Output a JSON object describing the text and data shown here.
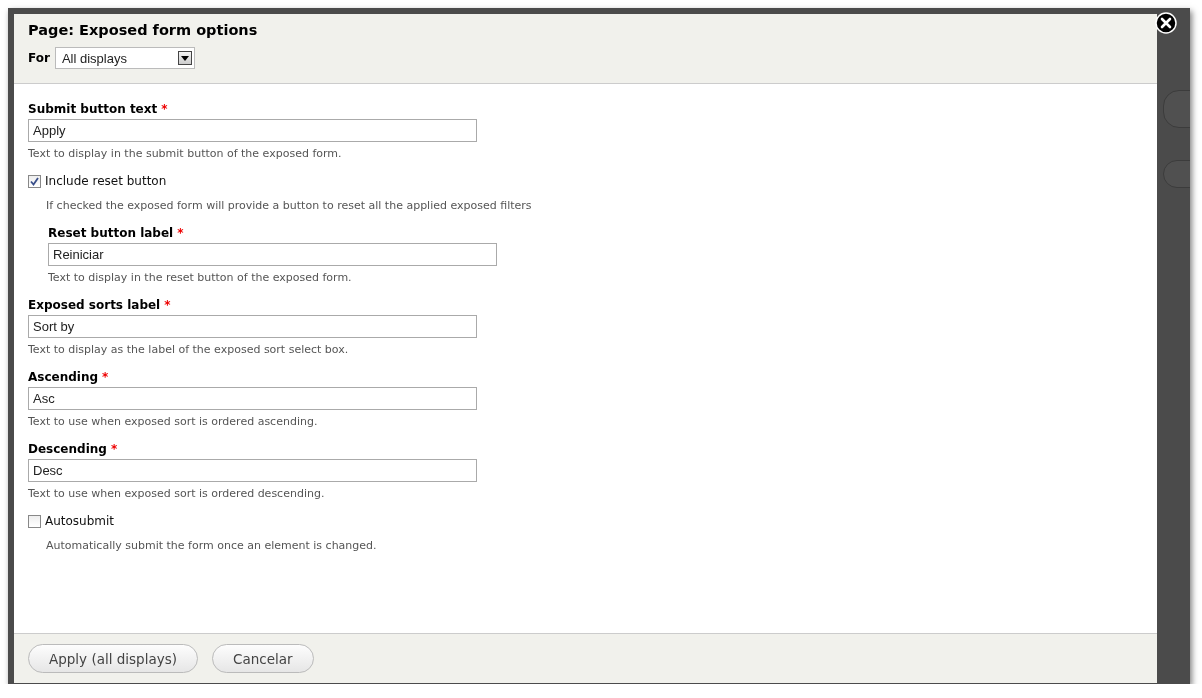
{
  "dialog": {
    "title": "Page: Exposed form options",
    "for_label": "For",
    "for_select": {
      "value": "All displays"
    }
  },
  "fields": [
    {
      "kind": "text",
      "label": "Submit button text",
      "required_mark": "*",
      "value": "Apply",
      "description": "Text to display in the submit button of the exposed form."
    },
    {
      "kind": "checkbox",
      "label": "Include reset button",
      "checked": true,
      "description": "If checked the exposed form will provide a button to reset all the applied exposed filters",
      "children": [
        {
          "kind": "text",
          "label": "Reset button label",
          "required_mark": "*",
          "value": "Reiniciar",
          "description": "Text to display in the reset button of the exposed form."
        }
      ]
    },
    {
      "kind": "text",
      "label": "Exposed sorts label",
      "required_mark": "*",
      "value": "Sort by",
      "description": "Text to display as the label of the exposed sort select box."
    },
    {
      "kind": "text",
      "label": "Ascending",
      "required_mark": "*",
      "value": "Asc",
      "description": "Text to use when exposed sort is ordered ascending."
    },
    {
      "kind": "text",
      "label": "Descending",
      "required_mark": "*",
      "value": "Desc",
      "description": "Text to use when exposed sort is ordered descending."
    },
    {
      "kind": "checkbox",
      "label": "Autosubmit",
      "checked": false,
      "description": "Automatically submit the form once an element is changed."
    }
  ],
  "buttons": [
    "Apply (all displays)",
    "Cancelar"
  ]
}
